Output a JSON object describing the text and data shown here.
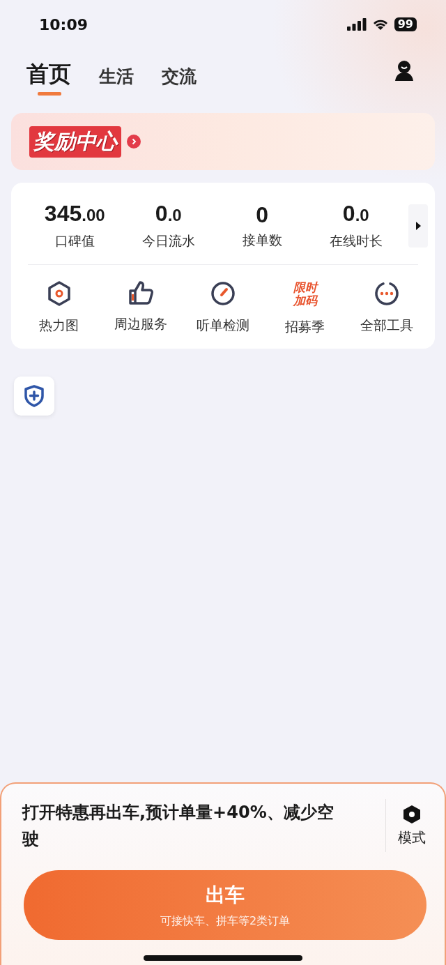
{
  "status_bar": {
    "time": "10:09",
    "battery": "99"
  },
  "tabs": [
    {
      "label": "首页",
      "selected": true
    },
    {
      "label": "生活",
      "selected": false
    },
    {
      "label": "交流",
      "selected": false
    }
  ],
  "banner": {
    "title": "奖励中心"
  },
  "stats": [
    {
      "main": "345",
      "decimal": ".00",
      "label": "口碑值"
    },
    {
      "main": "0",
      "decimal": ".0",
      "label": "今日流水"
    },
    {
      "main": "0",
      "label": "接单数"
    },
    {
      "main": "0",
      "decimal": ".0",
      "label": "在线时长"
    }
  ],
  "tools": [
    {
      "kind": "hexagon",
      "label": "热力图"
    },
    {
      "kind": "thumb",
      "label": "周边服务"
    },
    {
      "kind": "gauge",
      "label": "听单检测"
    },
    {
      "kind": "promo",
      "badge": [
        "限时",
        "加码"
      ],
      "label": "招募季"
    },
    {
      "kind": "more",
      "label": "全部工具"
    }
  ],
  "bottom_panel": {
    "tip": "打开特惠再出车,预计单量+40%、减少空驶",
    "mode_label": "模式",
    "go_button": {
      "title": "出车",
      "subtitle": "可接快车、拼车等2类订单"
    }
  }
}
